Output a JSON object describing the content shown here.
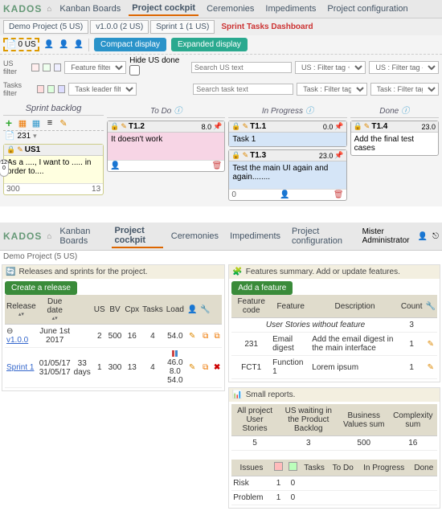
{
  "app1": {
    "logo": "KADOS",
    "nav": [
      "Kanban Boards",
      "Project cockpit",
      "Ceremonies",
      "Impediments",
      "Project configuration"
    ],
    "breadcrumb": [
      "Demo Project (5 US)",
      "v1.0.0 (2 US)",
      "Sprint 1 (1 US)",
      "Sprint Tasks Dashboard"
    ],
    "us_count": "0 US",
    "display_buttons": {
      "compact": "Compact display",
      "expanded": "Expanded display"
    },
    "filters": {
      "us_label": "US filter",
      "feature_ph": "Feature filter",
      "hide_us": "Hide US done",
      "search_us": "Search US text",
      "us_tag": "US : Filter tag +",
      "us_tag2": "US : Filter tag -",
      "task_label": "Tasks filter",
      "leader_ph": "Task leader filter",
      "search_task": "Search task text",
      "task_tag": "Task : Filter tag +",
      "task_tag2": "Task : Filter tag -"
    },
    "columns": {
      "backlog": {
        "title": "Sprint backlog",
        "count": "231"
      },
      "todo": {
        "title": "To Do"
      },
      "progress": {
        "title": "In Progress"
      },
      "done": {
        "title": "Done"
      }
    },
    "cards": {
      "us1": {
        "id": "US1",
        "text": "As a ...., I want to ..... in order to....",
        "f1": "300",
        "f2": "13"
      },
      "t12": {
        "id": "T1.2",
        "pts": "8.0",
        "text": "It doesn't work"
      },
      "t11": {
        "id": "T1.1",
        "pts": "0.0",
        "text": "Task 1"
      },
      "t13": {
        "id": "T1.3",
        "pts": "23.0",
        "text": "Test the main UI again and again........"
      },
      "t14": {
        "id": "T1.4",
        "pts": "23.0",
        "text": "Add the final test cases"
      },
      "zero": "0"
    }
  },
  "app2": {
    "nav": [
      "Kanban Boards",
      "Project cockpit",
      "Ceremonies",
      "Impediments",
      "Project configuration"
    ],
    "sub": "Demo Project (5 US)",
    "user": "Mister Administrator",
    "releases": {
      "title": "Releases and sprints for the project.",
      "create": "Create a release",
      "headers": [
        "Release",
        "Due date",
        "US",
        "BV",
        "Cpx",
        "Tasks",
        "Load"
      ],
      "rows": [
        {
          "rel": "v1.0.0",
          "due": "June 1st 2017",
          "days": "",
          "us": "2",
          "bv": "500",
          "cpx": "16",
          "tasks": "4",
          "load": "54.0"
        },
        {
          "rel": "Sprint 1",
          "due": "01/05/17 31/05/17",
          "days": "33 days",
          "us": "1",
          "bv": "300",
          "cpx": "13",
          "tasks": "4",
          "load": "46.0 8.0 54.0"
        }
      ]
    },
    "features": {
      "title": "Features summary. Add or update features.",
      "add": "Add a feature",
      "headers": [
        "Feature code",
        "Feature",
        "Description",
        "Count"
      ],
      "nofeat": "User Stories without feature",
      "nofeat_n": "3",
      "rows": [
        {
          "code": "231",
          "feat": "Email digest",
          "desc": "Add the email digest in the main interface",
          "n": "1"
        },
        {
          "code": "FCT1",
          "feat": "Function 1",
          "desc": "Lorem ipsum",
          "n": "1"
        }
      ]
    },
    "reports": {
      "title": "Small reports.",
      "t1": {
        "h": [
          "All project User Stories",
          "US waiting in the Product Backlog",
          "Business Values sum",
          "Complexity sum"
        ],
        "r": [
          "5",
          "3",
          "500",
          "16"
        ]
      },
      "t2": {
        "h": [
          "Issues",
          "",
          "",
          "Tasks",
          "To Do",
          "In Progress",
          "Done"
        ],
        "rows": [
          [
            "Risk",
            "1",
            "0",
            "",
            "",
            "",
            ""
          ],
          [
            "Problem",
            "1",
            "0",
            "",
            "",
            "",
            ""
          ]
        ]
      }
    }
  }
}
